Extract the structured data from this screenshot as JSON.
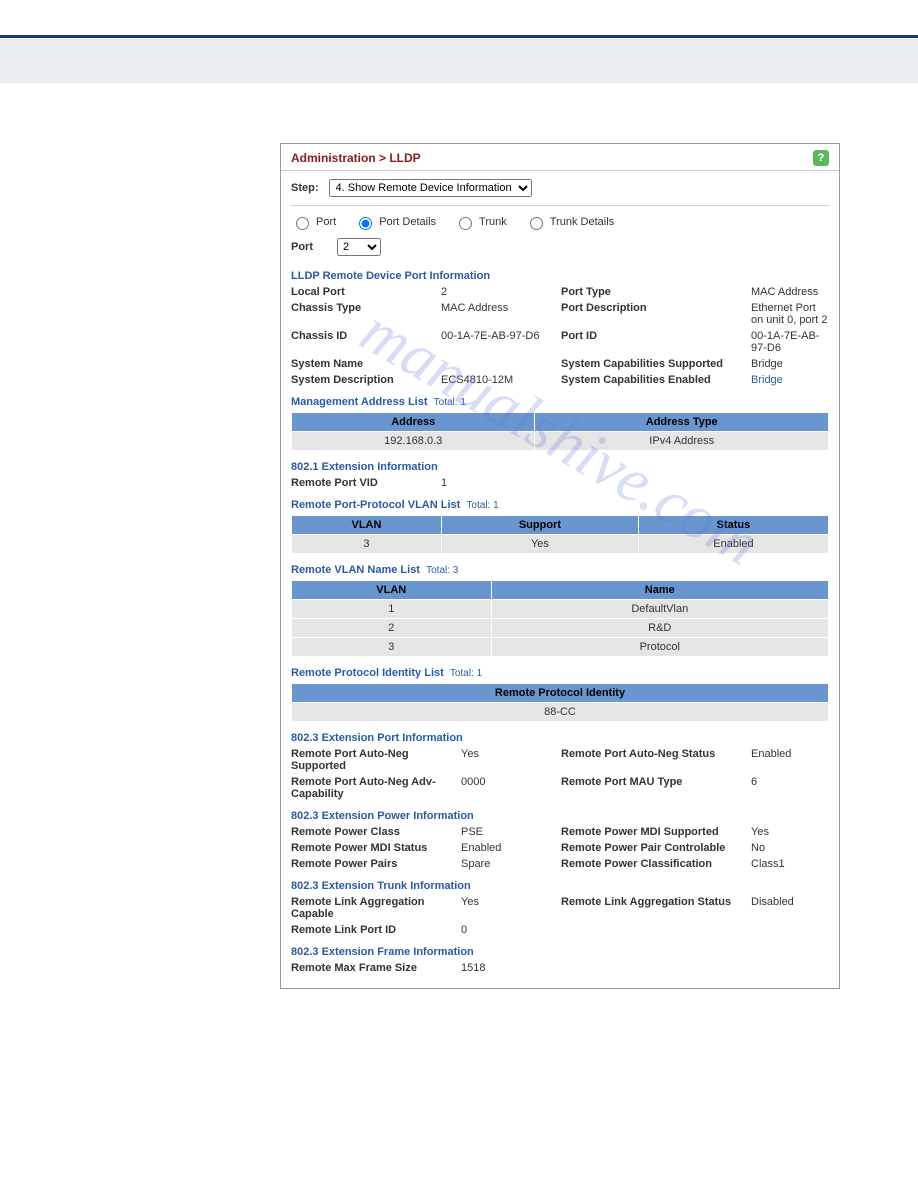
{
  "breadcrumb": "Administration > LLDP",
  "help_icon_label": "?",
  "step_label": "Step:",
  "step_selected": "4. Show Remote Device Information",
  "radios": {
    "port": "Port",
    "port_details": "Port Details",
    "trunk": "Trunk",
    "trunk_details": "Trunk Details"
  },
  "port_label": "Port",
  "port_value": "2",
  "section1_title": "LLDP Remote Device Port Information",
  "section1": [
    {
      "l": "Local Port",
      "v": "2",
      "l2": "Port Type",
      "v2": "MAC Address"
    },
    {
      "l": "Chassis Type",
      "v": "MAC Address",
      "l2": "Port Description",
      "v2": "Ethernet Port on unit 0, port 2"
    },
    {
      "l": "Chassis ID",
      "v": "00-1A-7E-AB-97-D6",
      "l2": "Port ID",
      "v2": "00-1A-7E-AB-97-D6"
    },
    {
      "l": "System Name",
      "v": "",
      "l2": "System Capabilities Supported",
      "v2": "Bridge"
    },
    {
      "l": "System Description",
      "v": "ECS4810-12M",
      "l2": "System Capabilities Enabled",
      "v2": "Bridge",
      "v2link": true
    }
  ],
  "mgmt_addr": {
    "title": "Management Address List",
    "total": "Total: 1",
    "headers": [
      "Address",
      "Address Type"
    ],
    "rows": [
      [
        "192.168.0.3",
        "IPv4 Address"
      ]
    ]
  },
  "ext8021_title": "802.1 Extension Information",
  "remote_port_vid_label": "Remote Port VID",
  "remote_port_vid_value": "1",
  "port_protocol_vlan": {
    "title": "Remote Port-Protocol VLAN List",
    "total": "Total: 1",
    "headers": [
      "VLAN",
      "Support",
      "Status"
    ],
    "rows": [
      [
        "3",
        "Yes",
        "Enabled"
      ]
    ]
  },
  "vlan_name": {
    "title": "Remote VLAN Name List",
    "total": "Total: 3",
    "headers": [
      "VLAN",
      "Name"
    ],
    "rows": [
      [
        "1",
        "DefaultVlan"
      ],
      [
        "2",
        "R&D"
      ],
      [
        "3",
        "Protocol"
      ]
    ]
  },
  "protocol_identity": {
    "title": "Remote Protocol Identity List",
    "total": "Total: 1",
    "headers": [
      "Remote Protocol Identity"
    ],
    "rows": [
      [
        "88-CC"
      ]
    ]
  },
  "ext8023_port_title": "802.3 Extension Port Information",
  "ext8023_port": [
    {
      "l": "Remote Port Auto-Neg Supported",
      "v": "Yes",
      "l2": "Remote Port Auto-Neg Status",
      "v2": "Enabled"
    },
    {
      "l": "Remote Port Auto-Neg Adv-Capability",
      "v": "0000",
      "l2": "Remote Port MAU Type",
      "v2": "6"
    }
  ],
  "ext8023_power_title": "802.3 Extension Power Information",
  "ext8023_power": [
    {
      "l": "Remote Power Class",
      "v": "PSE",
      "l2": "Remote Power MDI Supported",
      "v2": "Yes"
    },
    {
      "l": "Remote Power MDI Status",
      "v": "Enabled",
      "l2": "Remote Power Pair Controlable",
      "v2": "No"
    },
    {
      "l": "Remote Power Pairs",
      "v": "Spare",
      "l2": "Remote Power Classification",
      "v2": "Class1"
    }
  ],
  "ext8023_trunk_title": "802.3 Extension Trunk Information",
  "ext8023_trunk": [
    {
      "l": "Remote Link Aggregation Capable",
      "v": "Yes",
      "l2": "Remote Link Aggregation Status",
      "v2": "Disabled"
    },
    {
      "l": "Remote Link Port ID",
      "v": "0",
      "l2": "",
      "v2": ""
    }
  ],
  "ext8023_frame_title": "802.3 Extension Frame Information",
  "ext8023_frame": [
    {
      "l": "Remote Max Frame Size",
      "v": "1518",
      "l2": "",
      "v2": ""
    }
  ],
  "watermark": "manualshive.com"
}
